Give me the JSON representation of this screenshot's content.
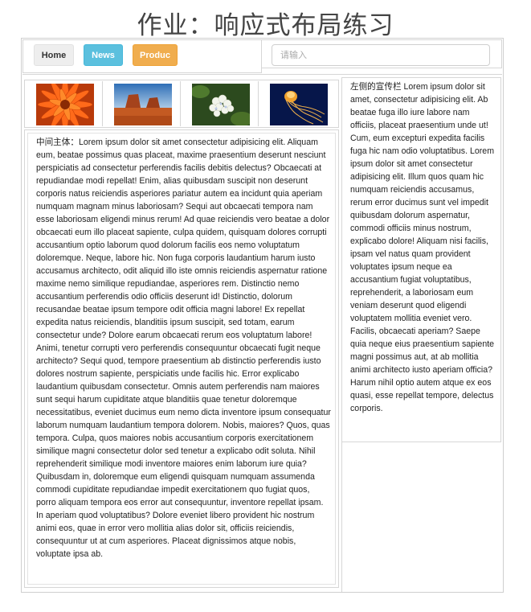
{
  "page": {
    "title": "作业：响应式布局练习"
  },
  "nav": {
    "buttons": [
      {
        "label": "Home",
        "color": "#eeeeee"
      },
      {
        "label": "News",
        "color": "#5bc0de"
      },
      {
        "label": "Produc",
        "color": "#f0ad4e"
      }
    ]
  },
  "search": {
    "placeholder": "请输入",
    "value": ""
  },
  "gallery": {
    "images": [
      {
        "subject": "orange-flower-photo"
      },
      {
        "subject": "desert-butte-photo"
      },
      {
        "subject": "white-hydrangea-photo"
      },
      {
        "subject": "jellyfish-photo"
      }
    ]
  },
  "main": {
    "text": "中间主体：Lorem ipsum dolor sit amet consectetur adipisicing elit. Aliquam eum, beatae possimus quas placeat, maxime praesentium deserunt nesciunt perspiciatis ad consectetur perferendis facilis debitis delectus? Obcaecati at repudiandae modi repellat! Enim, alias quibusdam suscipit non deserunt corporis natus reiciendis asperiores pariatur autem ea incidunt quia aperiam numquam magnam minus laboriosam? Sequi aut obcaecati tempora nam esse laboriosam eligendi minus rerum! Ad quae reiciendis vero beatae a dolor obcaecati eum illo placeat sapiente, culpa quidem, quisquam dolores corrupti accusantium optio laborum quod dolorum facilis eos nemo voluptatum doloremque. Neque, labore hic. Non fuga corporis laudantium harum iusto accusamus architecto, odit aliquid illo iste omnis reiciendis aspernatur ratione maxime nemo similique repudiandae, asperiores rem. Distinctio nemo accusantium perferendis odio officiis deserunt id! Distinctio, dolorum recusandae beatae ipsum tempore odit officia magni labore! Ex repellat expedita natus reiciendis, blanditiis ipsum suscipit, sed totam, earum consectetur unde? Dolore earum obcaecati rerum eos voluptatum labore! Animi, tenetur corrupti vero perferendis consequuntur obcaecati fugit neque architecto? Sequi quod, tempore praesentium ab distinctio perferendis iusto dolores nostrum sapiente, perspiciatis unde facilis hic. Error explicabo laudantium quibusdam consectetur. Omnis autem perferendis nam maiores sunt sequi harum cupiditate atque blanditiis quae tenetur doloremque necessitatibus, eveniet ducimus eum nemo dicta inventore ipsum consequatur laborum numquam laudantium tempora dolorem. Nobis, maiores? Quos, quas tempora. Culpa, quos maiores nobis accusantium corporis exercitationem similique magni consectetur dolor sed tenetur a explicabo odit soluta. Nihil reprehenderit similique modi inventore maiores enim laborum iure quia? Quibusdam in, doloremque eum eligendi quisquam numquam assumenda commodi cupiditate repudiandae impedit exercitationem quo fugiat quos, porro aliquam tempora eos error aut consequuntur, inventore repellat ipsam. In aperiam quod voluptatibus? Dolore eveniet libero provident hic nostrum animi eos, quae in error vero mollitia alias dolor sit, officiis reiciendis, consequuntur ut at cum asperiores. Placeat dignissimos atque nobis, voluptate ipsa ab."
  },
  "sidebar": {
    "text": "左侧的宣传栏 Lorem ipsum dolor sit amet, consectetur adipisicing elit. Ab beatae fuga illo iure labore nam officiis, placeat praesentium unde ut! Cum, eum excepturi expedita facilis fuga hic nam odio voluptatibus. Lorem ipsum dolor sit amet consectetur adipisicing elit. Illum quos quam hic numquam reiciendis accusamus, rerum error ducimus sunt vel impedit quibusdam dolorum aspernatur, commodi officiis minus nostrum, explicabo dolore! Aliquam nisi facilis, ipsam vel natus quam provident voluptates ipsum neque ea accusantium fugiat voluptatibus, reprehenderit, a laboriosam eum veniam deserunt quod eligendi voluptatem mollitia eveniet vero. Facilis, obcaecati aperiam? Saepe quia neque eius praesentium sapiente magni possimus aut, at ab mollitia animi architecto iusto aperiam officia? Harum nihil optio autem atque ex eos quasi, esse repellat tempore, delectus corporis."
  }
}
